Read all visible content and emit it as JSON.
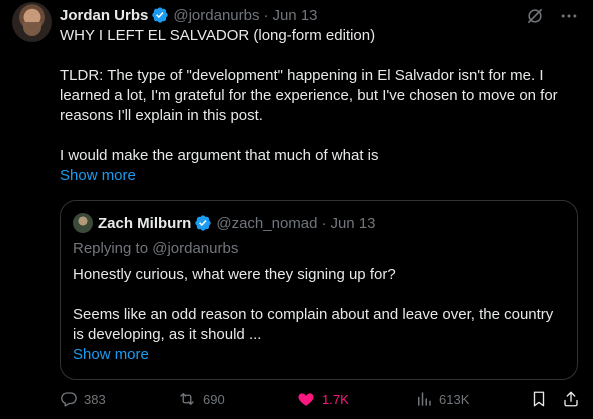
{
  "post": {
    "author_name": "Jordan Urbs",
    "handle": "@jordanurbs",
    "separator": "·",
    "date": "Jun 13",
    "paragraphs": [
      "WHY I LEFT EL SALVADOR (long-form edition)",
      "TLDR: The type of \"development\" happening in El Salvador isn't for me. I learned a lot, I'm grateful for the experience, but I've chosen to move on for reasons I'll explain in this post.",
      "I would make the argument that much of what is"
    ],
    "show_more": "Show more"
  },
  "quote": {
    "author_name": "Zach Milburn",
    "handle": "@zach_nomad",
    "separator": "·",
    "date": "Jun 13",
    "replying_to_prefix": "Replying to ",
    "replying_to_handle": "@jordanurbs",
    "paragraphs": [
      "Honestly curious, what were they signing up for?",
      "Seems like an odd reason to complain about and leave over, the country is developing, as it should ..."
    ],
    "show_more": "Show more"
  },
  "actions": {
    "replies": "383",
    "reposts": "690",
    "likes": "1.7K",
    "views": "613K"
  },
  "icons": {
    "verified": "verified-badge-icon",
    "grok": "grok-icon",
    "more": "more-icon",
    "reply": "reply-icon",
    "repost": "repost-icon",
    "like": "heart-icon",
    "views": "views-icon",
    "bookmark": "bookmark-icon",
    "share": "share-icon"
  },
  "colors": {
    "background": "#000000",
    "text": "#e7e9ea",
    "muted": "#71767b",
    "accent": "#1d9bf0",
    "like": "#f91880",
    "border": "#2f3336"
  }
}
